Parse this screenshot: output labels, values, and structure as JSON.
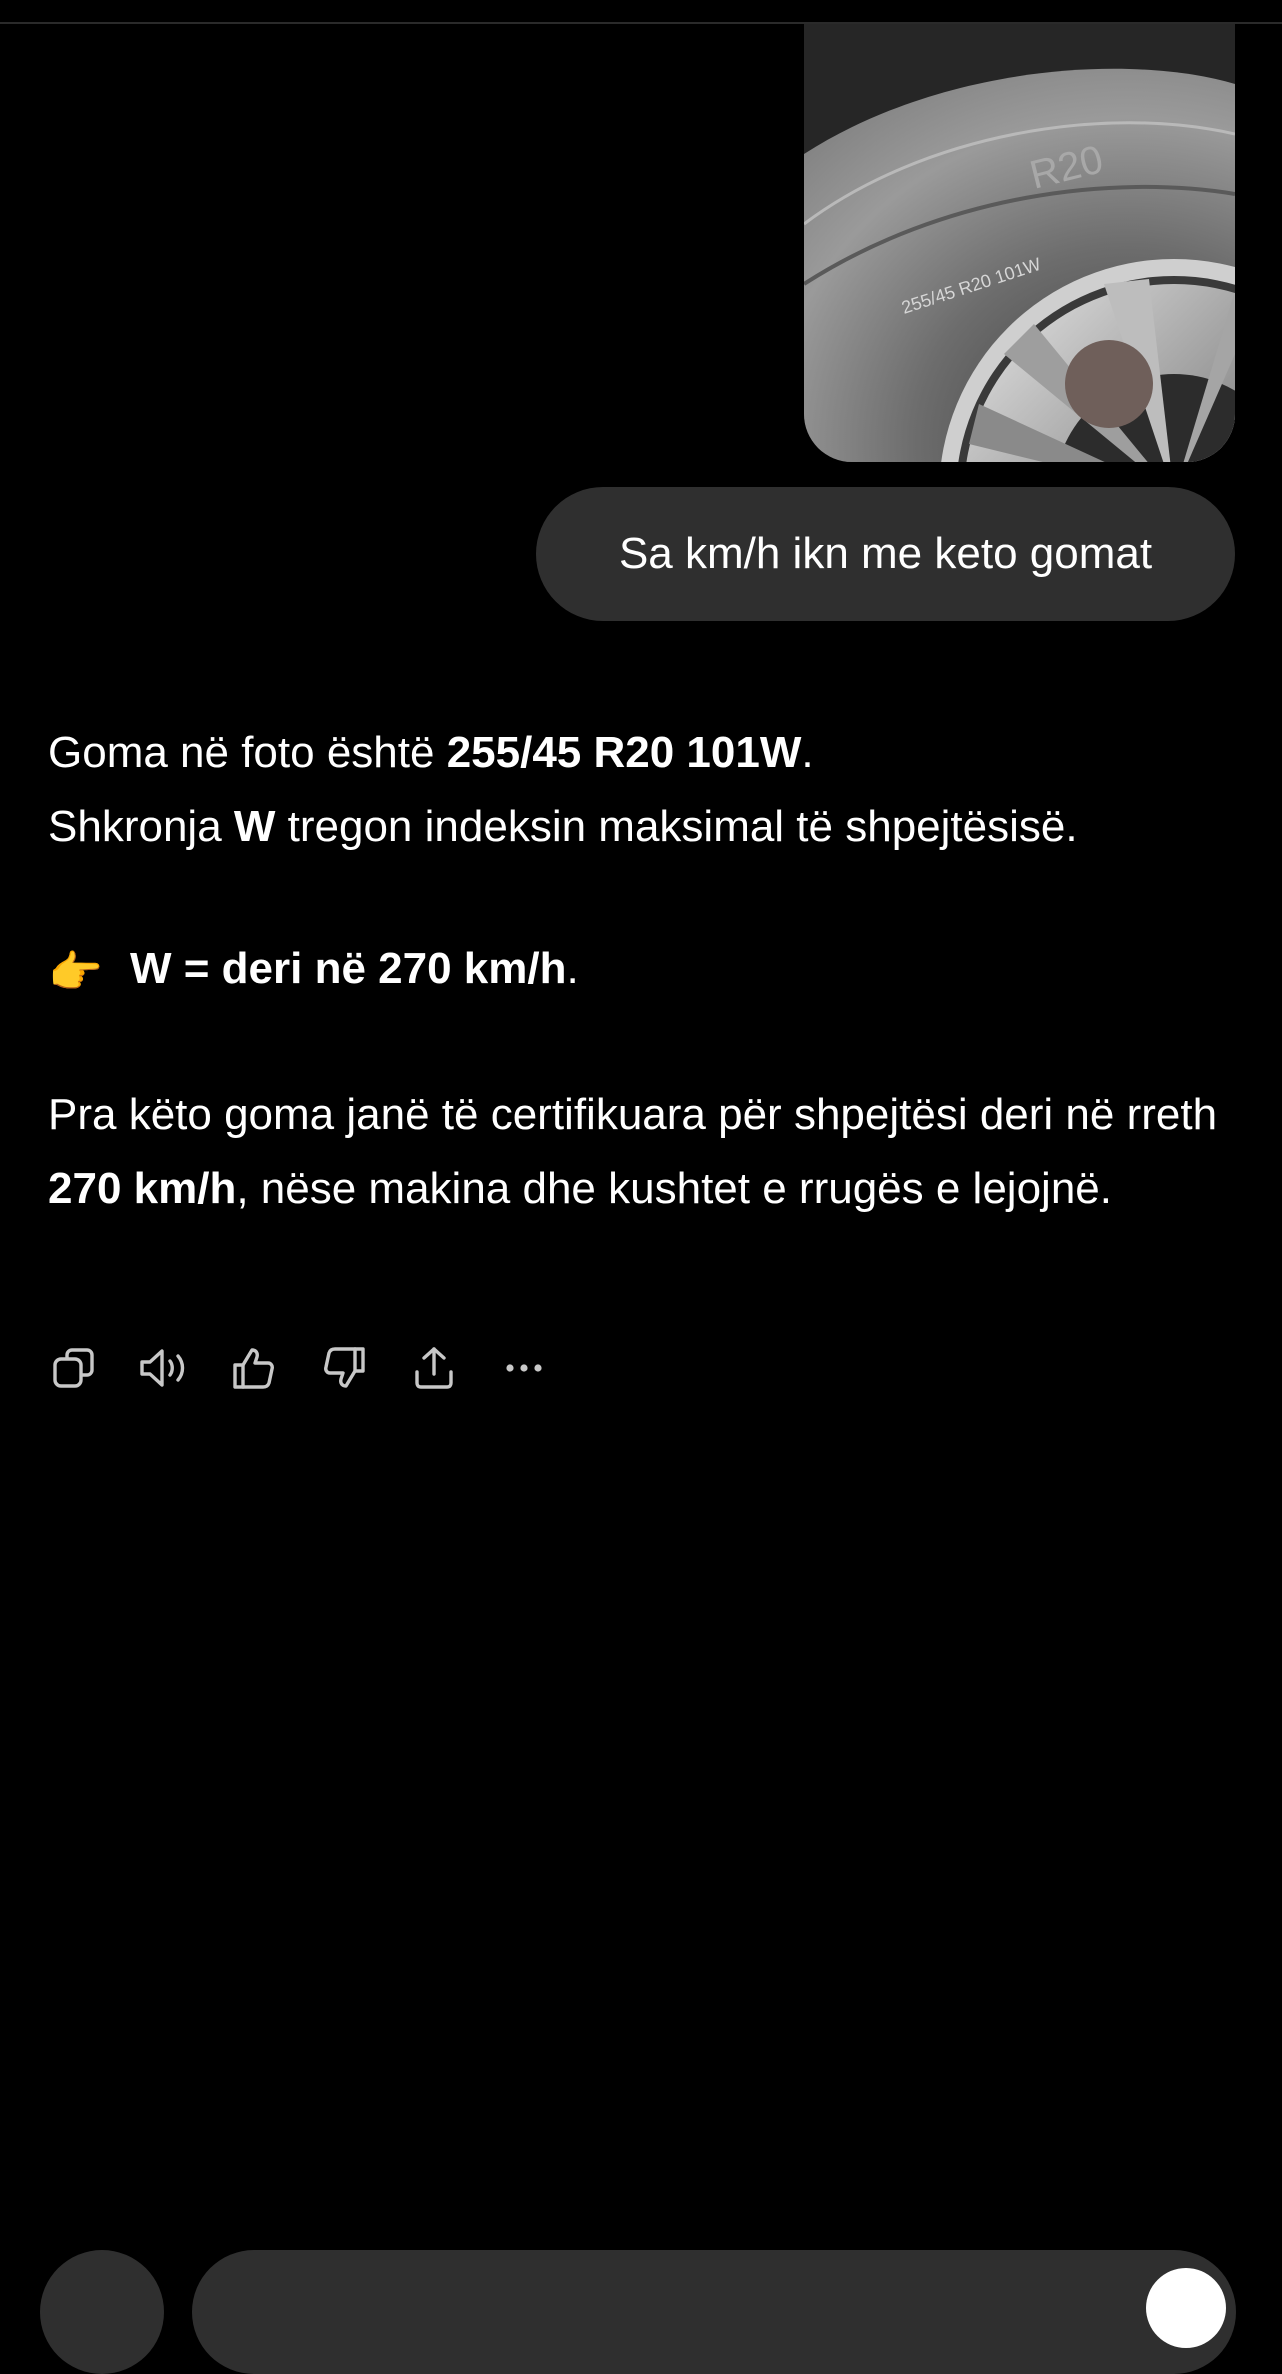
{
  "conversation": {
    "attachment": {
      "tire_marking_text": "255/45 R20 101W",
      "tire_size_text": "R20"
    },
    "user_message": "Sa km/h ikn me keto gomat",
    "assistant": {
      "line1_pre": "Goma në foto është ",
      "line1_bold": "255/45 R20 101W",
      "line1_post": ".",
      "line2_pre": "Shkronja ",
      "line2_bold": "W",
      "line2_post": " tregon indeksin maksimal të shpejtësisë.",
      "highlight_emoji": "👉",
      "highlight_bold": "W = deri në 270 km/h",
      "highlight_post": ".",
      "para_pre": "Pra këto goma janë të certifikuara për shpejtësi deri në rreth ",
      "para_bold": "270 km/h",
      "para_post": ", nëse makina dhe kushtet e rrugës e lejojnë."
    },
    "actions": [
      {
        "name": "copy-icon"
      },
      {
        "name": "read-aloud-icon"
      },
      {
        "name": "thumbs-up-icon"
      },
      {
        "name": "thumbs-down-icon"
      },
      {
        "name": "share-icon"
      },
      {
        "name": "more-icon"
      }
    ]
  },
  "colors": {
    "background": "#000000",
    "bubble": "#2f2f2f",
    "text": "#ffffff",
    "icon": "#c8c8c8"
  }
}
